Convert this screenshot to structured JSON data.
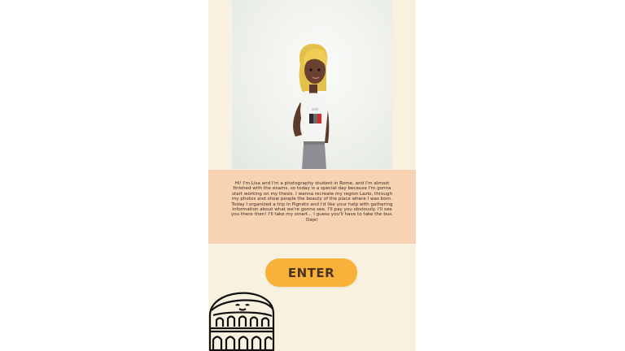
{
  "character": {
    "icon": "avatar-lisa-illustration",
    "shirt_flag_colors": [
      "#2b2b2b",
      "#d42a2a"
    ]
  },
  "story": {
    "paragraph_1": "Hi! I'm Lisa and I'm a photography student in Rome, and I'm almost finished with the exams, so today is a special day because I'm gonna start working on my thesis. I wanna recreate my region Lazio, through my photos and show people the beauty of the place where I was born.",
    "paragraph_2": "Today I organized a trip in Pigneto and I'd like your help with gathering information about what we're gonna see, I'll pay you obviously. I'll see you there then! I'll take my smart... I guess you'll have to take the bus. Daje!"
  },
  "actions": {
    "enter_label": "ENTER"
  },
  "decoration": {
    "icon": "colosseum-icon"
  },
  "colors": {
    "background": "#f8f1e0",
    "story_panel": "#f7d3b3",
    "button": "#f9b13a"
  }
}
